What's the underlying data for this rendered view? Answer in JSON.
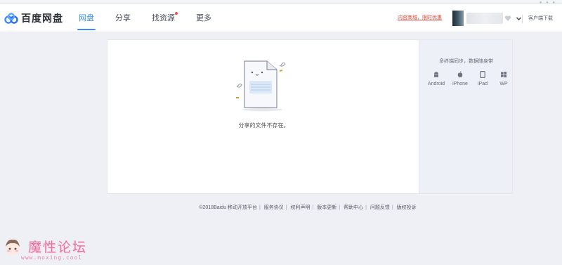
{
  "app": {
    "brand_name": "百度网盘",
    "brand_color": "#3b8cff"
  },
  "nav": {
    "items": [
      {
        "label": "网盘",
        "active": true
      },
      {
        "label": "分享"
      },
      {
        "label": "找资源",
        "badge": "red-dot"
      },
      {
        "label": "更多"
      }
    ]
  },
  "header": {
    "promo_text": "内容商城，限时优惠",
    "client_download": "客户端下载",
    "icons": {
      "vip": "vip-heart-icon",
      "caret": "chevron-down-icon"
    }
  },
  "main": {
    "empty_message": "分享的文件不存在。",
    "illustration": "empty-document-illustration"
  },
  "sidebar": {
    "title": "多终端同步，数据随身带",
    "platforms": [
      {
        "label": "Android",
        "icon": "android-icon"
      },
      {
        "label": "iPhone",
        "icon": "apple-icon"
      },
      {
        "label": "iPad",
        "icon": "ipad-icon"
      },
      {
        "label": "WP",
        "icon": "windows-icon"
      }
    ]
  },
  "footer": {
    "copyright": "©2018Baidu",
    "links": [
      "移动开放平台",
      "服务协议",
      "权利声明",
      "版本更新",
      "帮助中心",
      "问题反馈",
      "版权投诉"
    ]
  },
  "watermark": {
    "title": "魔性论坛",
    "url": "www.moxing.cool"
  }
}
